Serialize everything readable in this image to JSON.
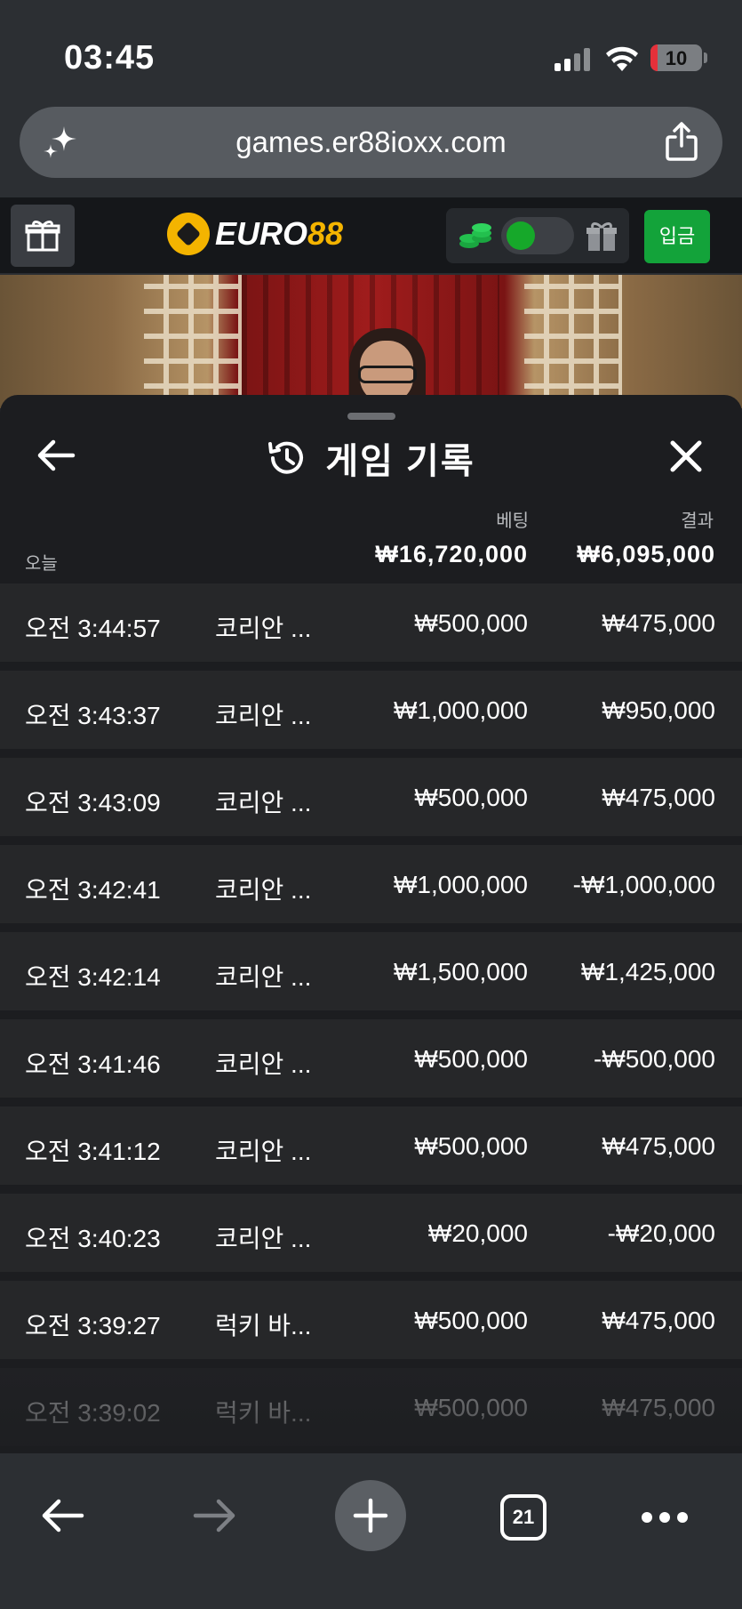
{
  "status_bar": {
    "time": "03:45",
    "battery": "10",
    "battery_color": "#e5303a"
  },
  "browser": {
    "url": "games.er88ioxx.com",
    "tab_count": "21",
    "icons": [
      "sparkle-icon",
      "share-icon",
      "back-arrow-icon",
      "forward-arrow-icon",
      "plus-icon",
      "tabs-icon",
      "more-icon"
    ]
  },
  "site_header": {
    "logo_text_white": "EURO",
    "logo_text_yellow": "88",
    "deposit_label": "입금",
    "accent_color": "#13a33a",
    "brand_color": "#f4b400"
  },
  "history": {
    "title": "게임 기록",
    "bet_header": "베팅",
    "result_header": "결과",
    "today_label": "오늘",
    "total_bet": "₩16,720,000",
    "total_result": "₩6,095,000",
    "rows": [
      {
        "time": "오전 3:44:57",
        "game": "코리안 ...",
        "bet": "₩500,000",
        "result": "₩475,000"
      },
      {
        "time": "오전 3:43:37",
        "game": "코리안 ...",
        "bet": "₩1,000,000",
        "result": "₩950,000"
      },
      {
        "time": "오전 3:43:09",
        "game": "코리안 ...",
        "bet": "₩500,000",
        "result": "₩475,000"
      },
      {
        "time": "오전 3:42:41",
        "game": "코리안 ...",
        "bet": "₩1,000,000",
        "result": "-₩1,000,000"
      },
      {
        "time": "오전 3:42:14",
        "game": "코리안 ...",
        "bet": "₩1,500,000",
        "result": "₩1,425,000"
      },
      {
        "time": "오전 3:41:46",
        "game": "코리안 ...",
        "bet": "₩500,000",
        "result": "-₩500,000"
      },
      {
        "time": "오전 3:41:12",
        "game": "코리안 ...",
        "bet": "₩500,000",
        "result": "₩475,000"
      },
      {
        "time": "오전 3:40:23",
        "game": "코리안 ...",
        "bet": "₩20,000",
        "result": "-₩20,000"
      },
      {
        "time": "오전 3:39:27",
        "game": "럭키 바...",
        "bet": "₩500,000",
        "result": "₩475,000"
      },
      {
        "time": "오전 3:39:02",
        "game": "럭키 바...",
        "bet": "₩500,000",
        "result": "₩475,000"
      }
    ]
  }
}
